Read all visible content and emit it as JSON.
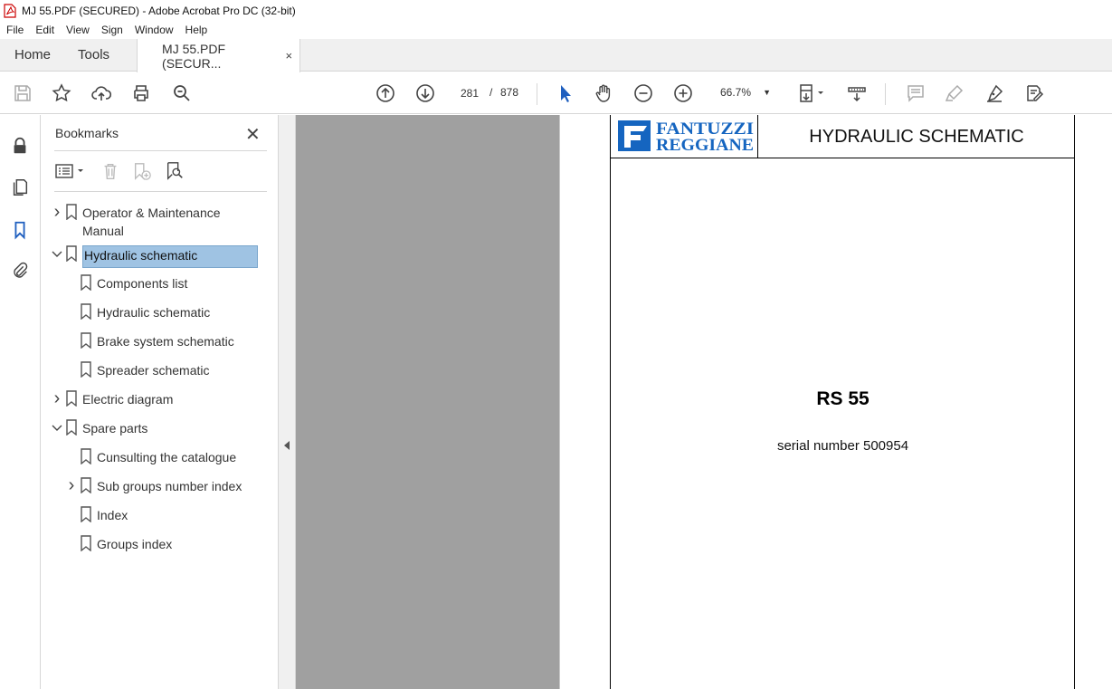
{
  "window": {
    "title": "MJ 55.PDF (SECURED) - Adobe Acrobat Pro DC (32-bit)"
  },
  "menu": [
    "File",
    "Edit",
    "View",
    "Sign",
    "Window",
    "Help"
  ],
  "tabs": {
    "home": "Home",
    "tools": "Tools",
    "document": "MJ 55.PDF (SECUR...",
    "close": "×"
  },
  "toolbar": {
    "current_page": "281",
    "page_separator": "/",
    "total_pages": "878",
    "zoom": "66.7%"
  },
  "bookmarks_panel": {
    "title": "Bookmarks",
    "close": "✕",
    "items": [
      {
        "label": "Operator & Maintenance Manual",
        "level": 0,
        "expander": "collapsed"
      },
      {
        "label": "Hydraulic schematic",
        "level": 0,
        "expander": "expanded",
        "selected": true
      },
      {
        "label": "Components list",
        "level": 1,
        "expander": "none"
      },
      {
        "label": "Hydraulic schematic",
        "level": 1,
        "expander": "none"
      },
      {
        "label": "Brake system schematic",
        "level": 1,
        "expander": "none"
      },
      {
        "label": "Spreader schematic",
        "level": 1,
        "expander": "none"
      },
      {
        "label": "Electric diagram",
        "level": 0,
        "expander": "collapsed"
      },
      {
        "label": "Spare parts",
        "level": 0,
        "expander": "expanded"
      },
      {
        "label": "Cunsulting the catalogue",
        "level": 1,
        "expander": "none"
      },
      {
        "label": "Sub groups number index",
        "level": 1,
        "expander": "collapsed"
      },
      {
        "label": "Index",
        "level": 1,
        "expander": "none"
      },
      {
        "label": "Groups index",
        "level": 1,
        "expander": "none"
      }
    ]
  },
  "document": {
    "logo_line1": "FANTUZZI",
    "logo_line2": "REGGIANE",
    "header_title": "HYDRAULIC SCHEMATIC",
    "model": "RS 55",
    "serial": "serial number 500954"
  },
  "colors": {
    "accent_blue": "#1f5fbf",
    "selection": "#9fc3e3",
    "logo_blue": "#1565c0"
  }
}
